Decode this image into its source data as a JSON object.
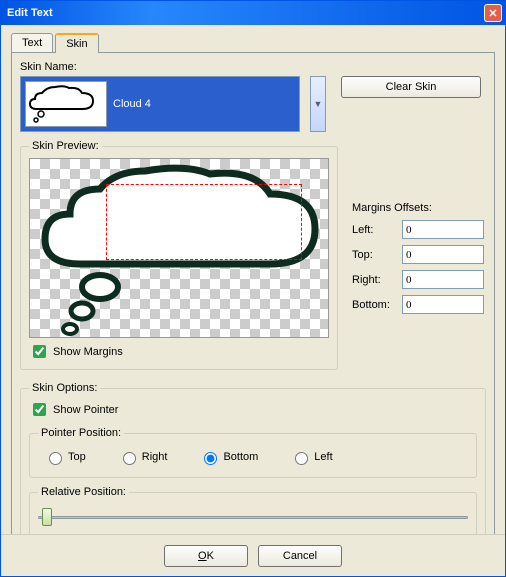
{
  "window": {
    "title": "Edit Text"
  },
  "tabs": {
    "text": "Text",
    "skin": "Skin"
  },
  "skinName": {
    "label": "Skin Name:",
    "value": "Cloud 4"
  },
  "buttons": {
    "clearSkin": "Clear Skin",
    "ok": "OK",
    "cancel": "Cancel"
  },
  "preview": {
    "label": "Skin Preview:",
    "showMargins": "Show Margins"
  },
  "marginsOffsets": {
    "label": "Margins Offsets:",
    "left": {
      "label": "Left:",
      "value": "0"
    },
    "top": {
      "label": "Top:",
      "value": "0"
    },
    "right": {
      "label": "Right:",
      "value": "0"
    },
    "bottom": {
      "label": "Bottom:",
      "value": "0"
    }
  },
  "skinOptions": {
    "label": "Skin Options:",
    "showPointer": "Show Pointer",
    "pointerPosition": {
      "label": "Pointer Position:",
      "top": "Top",
      "right": "Right",
      "bottom": "Bottom",
      "left": "Left",
      "selected": "bottom"
    },
    "relativePosition": {
      "label": "Relative Position:"
    }
  }
}
